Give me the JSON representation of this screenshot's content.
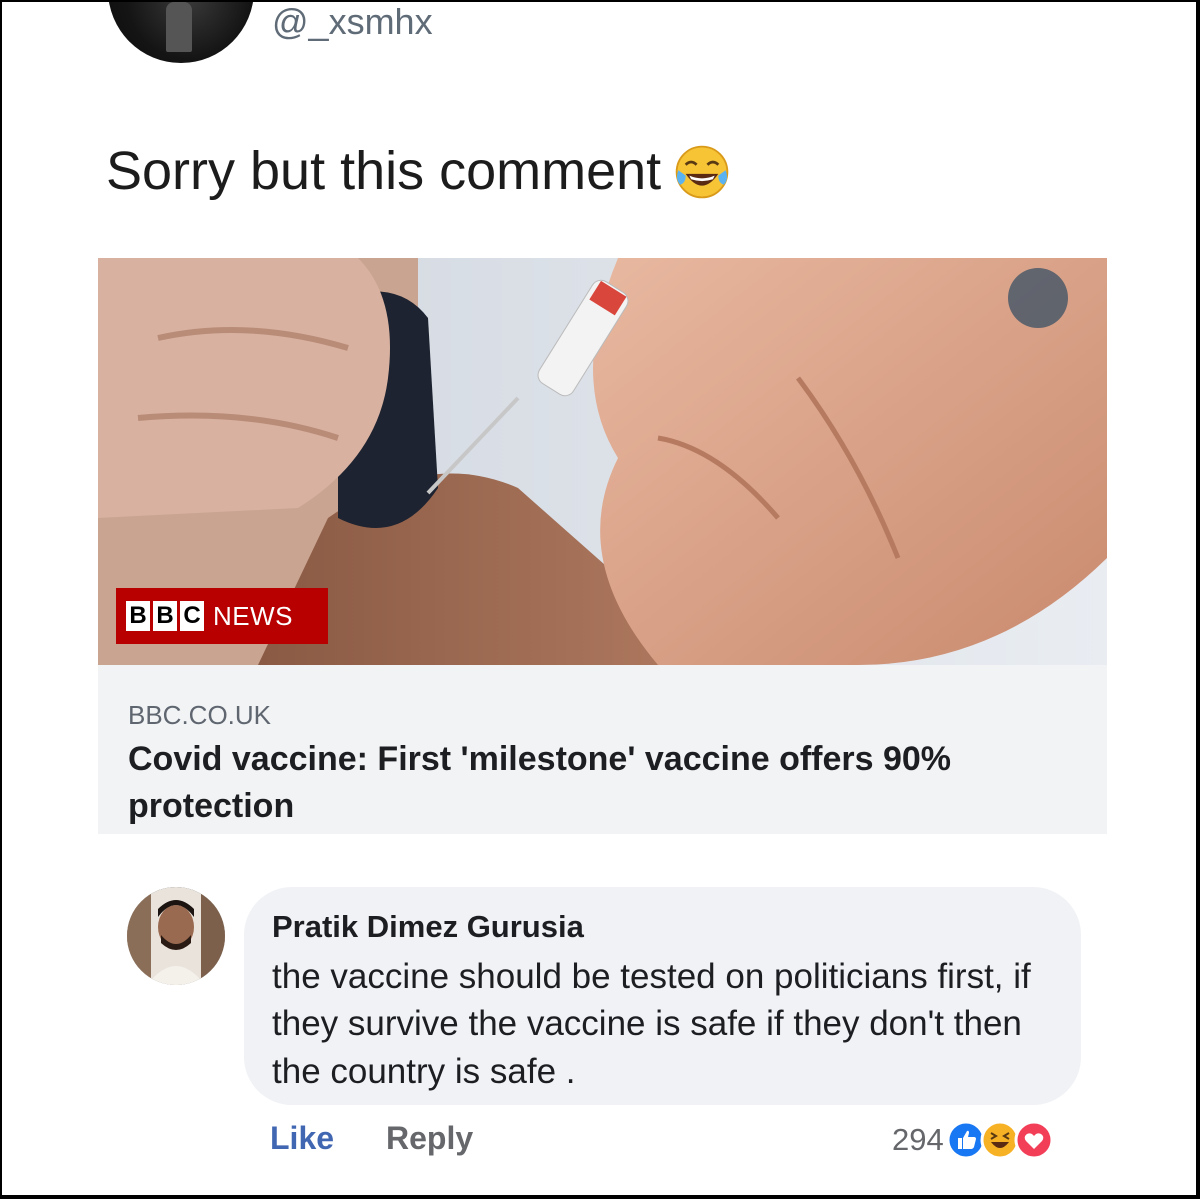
{
  "tweet": {
    "handle": "@_xsmhx",
    "text": "Sorry but this comment",
    "emoji": "face-with-tears-of-joy-icon"
  },
  "link_card": {
    "image_badge": {
      "blocks": [
        "B",
        "B",
        "C"
      ],
      "label": "NEWS"
    },
    "domain": "BBC.CO.UK",
    "title": "Covid vaccine: First 'milestone' vaccine offers 90% protection"
  },
  "comment": {
    "author": "Pratik Dimez Gurusia",
    "text": "the vaccine should be tested on politicians first, if they survive the vaccine is safe if they don't then the country is safe .",
    "actions": {
      "like": "Like",
      "reply": "Reply"
    },
    "reactions": {
      "count": "294",
      "icons": [
        "like-reaction-icon",
        "haha-reaction-icon",
        "love-reaction-icon"
      ]
    }
  },
  "colors": {
    "facebook_blue": "#4267b2",
    "bbc_red": "#b80000",
    "love_red": "#f33e58",
    "haha_yellow": "#f7b125"
  }
}
